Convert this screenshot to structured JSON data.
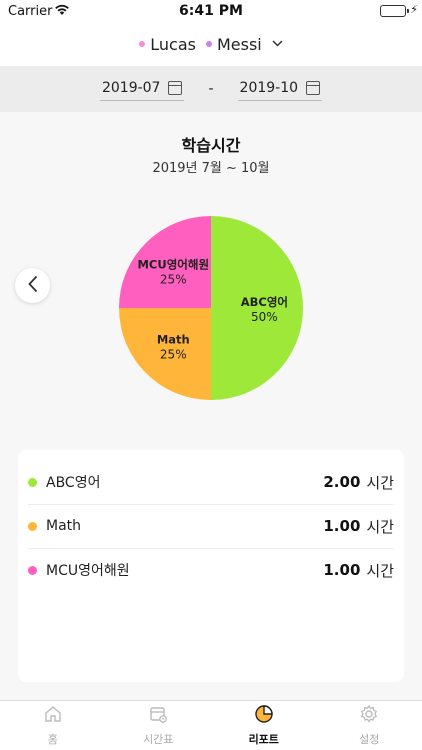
{
  "status": {
    "carrier": "Carrier",
    "time": "6:41 PM"
  },
  "header": {
    "kids": [
      {
        "name": "Lucas",
        "color": "#ff8ad8"
      },
      {
        "name": "Messi",
        "color": "#d07fe8"
      }
    ]
  },
  "range": {
    "start": "2019-07",
    "sep": "-",
    "end": "2019-10"
  },
  "report": {
    "title": "학습시간",
    "subtitle": "2019년 7월 ~ 10월"
  },
  "chart_data": {
    "type": "pie",
    "slices": [
      {
        "label": "ABC영어",
        "percent": 50,
        "value_label": "50%",
        "color": "#9ee83a"
      },
      {
        "label": "Math",
        "percent": 25,
        "value_label": "25%",
        "color": "#ffb43a"
      },
      {
        "label": "MCU영어해원",
        "percent": 25,
        "value_label": "25%",
        "color": "#ff5fbe"
      }
    ]
  },
  "legend": [
    {
      "name": "ABC영어",
      "value": "2.00",
      "unit": "시간",
      "color": "#9ee83a"
    },
    {
      "name": "Math",
      "value": "1.00",
      "unit": "시간",
      "color": "#ffb43a"
    },
    {
      "name": "MCU영어해원",
      "value": "1.00",
      "unit": "시간",
      "color": "#ff5fbe"
    }
  ],
  "tabs": [
    {
      "label": "홈",
      "icon": "home-icon"
    },
    {
      "label": "시간표",
      "icon": "schedule-icon"
    },
    {
      "label": "리포트",
      "icon": "report-icon",
      "active": true
    },
    {
      "label": "설정",
      "icon": "gear-icon"
    }
  ]
}
